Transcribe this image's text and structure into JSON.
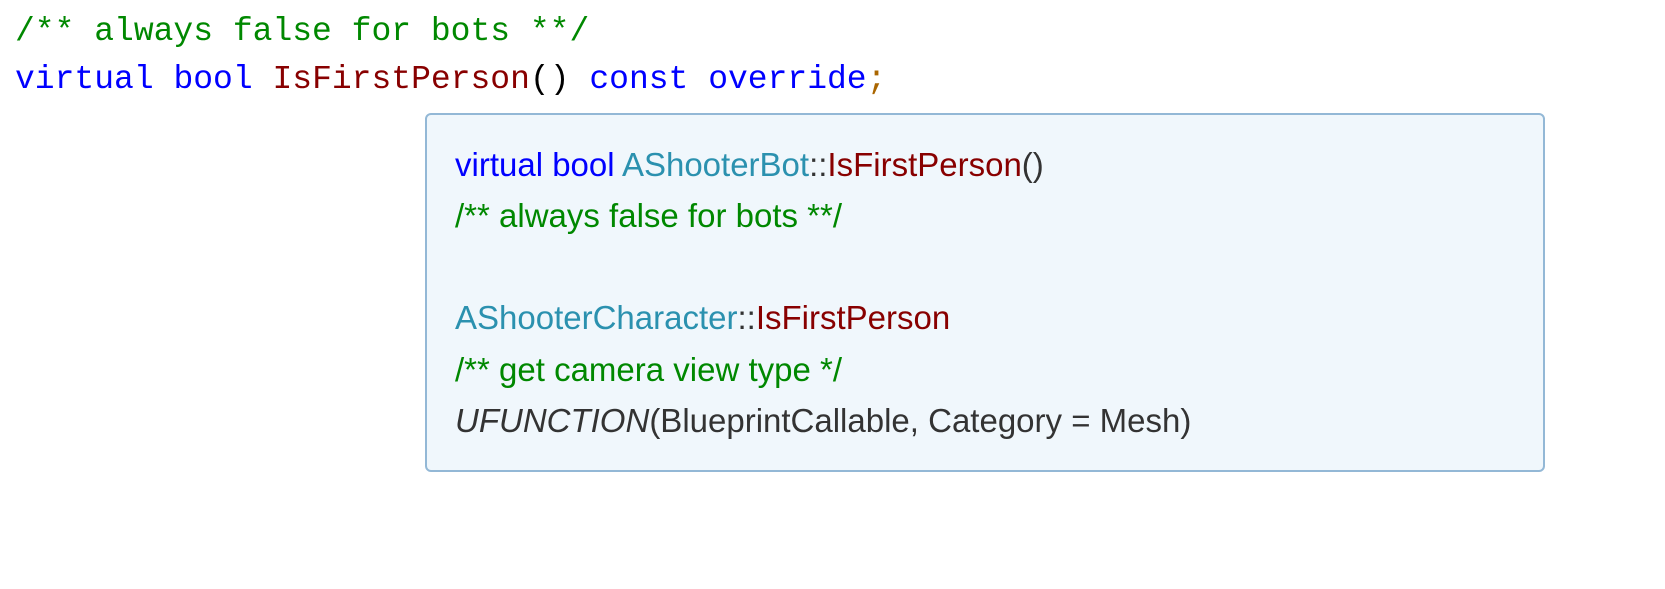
{
  "code": {
    "line1": {
      "comment": "/** always false for bots **/"
    },
    "line2": {
      "kw_virtual": "virtual",
      "kw_bool": "bool",
      "space": " ",
      "funcname": "IsFirstPerson",
      "parens": "()",
      "kw_const": "const",
      "kw_override": "override",
      "semi": ";"
    }
  },
  "tooltip": {
    "line1": {
      "kw_virtual": "virtual",
      "kw_bool": "bool",
      "space": " ",
      "classname": "AShooterBot",
      "dcolon": "::",
      "funcname": "IsFirstPerson",
      "parens": "()"
    },
    "line2": {
      "comment": "/** always false for bots **/"
    },
    "line3": {
      "classname": "AShooterCharacter",
      "dcolon": "::",
      "funcname": "IsFirstPerson"
    },
    "line4": {
      "comment": "/** get camera view type */"
    },
    "line5": {
      "macro": "UFUNCTION",
      "rest": "(BlueprintCallable, Category = Mesh)"
    }
  }
}
